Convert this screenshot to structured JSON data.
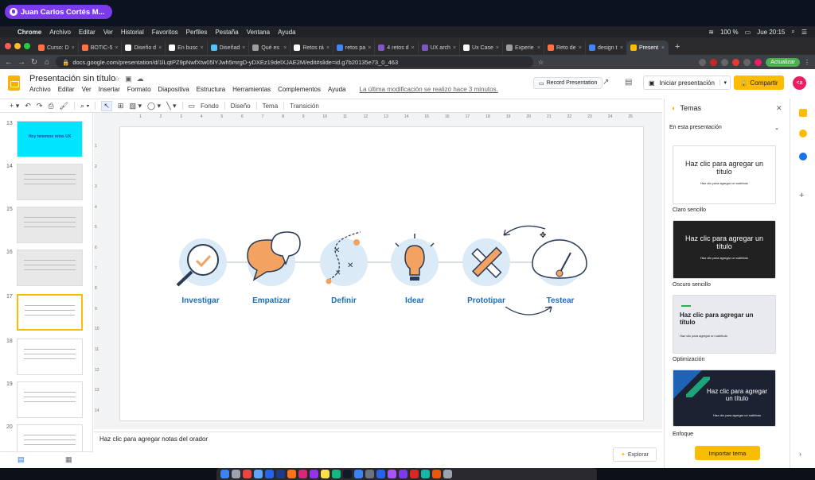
{
  "session_pill": {
    "name": "Juan Carlos Cortés M..."
  },
  "menubar": {
    "app": "Chrome",
    "items": [
      "Archivo",
      "Editar",
      "Ver",
      "Historial",
      "Favoritos",
      "Perfiles",
      "Pestaña",
      "Ventana",
      "Ayuda"
    ],
    "battery": "100 %",
    "clock": "Jue 20:15"
  },
  "tabs": [
    {
      "label": "Curso: D",
      "color": "#ff7043"
    },
    {
      "label": "BOTIC-5",
      "color": "#ff7043"
    },
    {
      "label": "Diseño d",
      "color": "#ffffff"
    },
    {
      "label": "En busc",
      "color": "#ffffff"
    },
    {
      "label": "Diseñad",
      "color": "#4fc3f7"
    },
    {
      "label": "Qué es",
      "color": "#9e9e9e"
    },
    {
      "label": "Retos rá",
      "color": "#ffffff"
    },
    {
      "label": "retos pa",
      "color": "#4285f4"
    },
    {
      "label": "4 retos d",
      "color": "#7e57c2"
    },
    {
      "label": "UX arch",
      "color": "#7e57c2"
    },
    {
      "label": "Ux Case",
      "color": "#ffffff"
    },
    {
      "label": "Experie",
      "color": "#9e9e9e"
    },
    {
      "label": "Reto de",
      "color": "#ff7043"
    },
    {
      "label": "design t",
      "color": "#4285f4"
    },
    {
      "label": "Present",
      "color": "#fbbc04",
      "active": true
    }
  ],
  "addressbar": {
    "url": "docs.google.com/presentation/d/1lLqtPZ9pNwfXtw05lYJwh5mrgD-yDXEz19delXJAE2M/edit#slide=id.g7b20135e73_0_463",
    "update_label": "Actualizar"
  },
  "doc": {
    "title": "Presentación sin título",
    "menus": [
      "Archivo",
      "Editar",
      "Ver",
      "Insertar",
      "Formato",
      "Diapositiva",
      "Estructura",
      "Herramientas",
      "Complementos",
      "Ayuda"
    ],
    "last_edit": "La última modificación se realizó hace 3 minutos.",
    "record_label": "Record Presentation",
    "present_label": "Iniciar presentación",
    "share_label": "Compartir",
    "avatar_initials": "<a"
  },
  "toolbar": {
    "fondo": "Fondo",
    "diseno": "Diseño",
    "tema": "Tema",
    "transicion": "Transición"
  },
  "slides": [
    {
      "num": "13",
      "text": "Hoy tenemos retos UX",
      "bg": "#00e5ff"
    },
    {
      "num": "14",
      "text": "",
      "bg": "#e8e8e8"
    },
    {
      "num": "15",
      "text": "",
      "bg": "#e8e8e8"
    },
    {
      "num": "16",
      "text": "",
      "bg": "#e8e8e8"
    },
    {
      "num": "17",
      "text": "",
      "bg": "#ffffff",
      "selected": true
    },
    {
      "num": "18",
      "text": "",
      "bg": "#ffffff"
    },
    {
      "num": "19",
      "text": "",
      "bg": "#ffffff"
    },
    {
      "num": "20",
      "text": "",
      "bg": "#ffffff"
    }
  ],
  "canvas": {
    "steps": [
      "Investigar",
      "Empatizar",
      "Definir",
      "Idear",
      "Prototipar",
      "Testear"
    ],
    "ruler_ticks": [
      "1",
      "2",
      "3",
      "4",
      "5",
      "6",
      "7",
      "8",
      "9",
      "10",
      "11",
      "12",
      "13",
      "14",
      "15",
      "16",
      "17",
      "18",
      "19",
      "20",
      "21",
      "22",
      "23",
      "24",
      "25"
    ],
    "vruler_ticks": [
      "1",
      "2",
      "3",
      "4",
      "5",
      "6",
      "7",
      "8",
      "9",
      "10",
      "11",
      "12",
      "13",
      "14"
    ],
    "notes_placeholder": "Haz clic para agregar notas del orador",
    "explore_label": "Explorar"
  },
  "themes": {
    "title": "Temas",
    "scope": "En esta presentación",
    "cards": [
      {
        "name": "Claro sencillo",
        "title": "Haz clic para agregar un título",
        "subtitle": "Haz clic para agregar un subtítulo",
        "bg": "#ffffff",
        "fg": "#202124"
      },
      {
        "name": "Oscuro sencillo",
        "title": "Haz clic para agregar un título",
        "subtitle": "Haz clic para agregar un subtítulo",
        "bg": "#212121",
        "fg": "#ffffff"
      },
      {
        "name": "Optimización",
        "title": "Haz clic para agregar un título",
        "subtitle": "Haz clic para agregar un subtítulo",
        "bg": "#e8eaed",
        "fg": "#202124"
      },
      {
        "name": "Enfoque",
        "title": "Haz clic para agregar un título",
        "subtitle": "Haz clic para agregar un subtítulo",
        "bg": "#1c2231",
        "fg": "#ffffff"
      }
    ],
    "import_label": "Importar tema"
  },
  "colors": {
    "accent_yellow": "#fbbc04",
    "step_blue": "#1f6fb2",
    "icon_orange": "#f4a261",
    "icon_bg": "#dbeaf7"
  }
}
